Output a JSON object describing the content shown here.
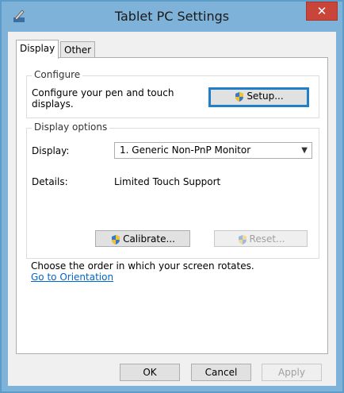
{
  "window": {
    "title": "Tablet PC Settings",
    "close_label": "✕"
  },
  "tabs": [
    {
      "label": "Display"
    },
    {
      "label": "Other"
    }
  ],
  "configure": {
    "group_label": "Configure",
    "description": "Configure your pen and touch displays.",
    "setup_label": "Setup..."
  },
  "display_options": {
    "group_label": "Display options",
    "display_label": "Display:",
    "display_value": "1. Generic Non-PnP Monitor",
    "details_label": "Details:",
    "details_value": "Limited Touch Support",
    "calibrate_label": "Calibrate...",
    "reset_label": "Reset..."
  },
  "orientation": {
    "text": "Choose the order in which your screen rotates.",
    "link": "Go to Orientation"
  },
  "footer": {
    "ok_label": "OK",
    "cancel_label": "Cancel",
    "apply_label": "Apply"
  },
  "colors": {
    "frame": "#7fb2d8",
    "close": "#c9453a",
    "focus": "#1f7fc8",
    "link": "#0066cc"
  },
  "icons": {
    "app": "tablet-pen-icon",
    "shield": "uac-shield-icon"
  }
}
